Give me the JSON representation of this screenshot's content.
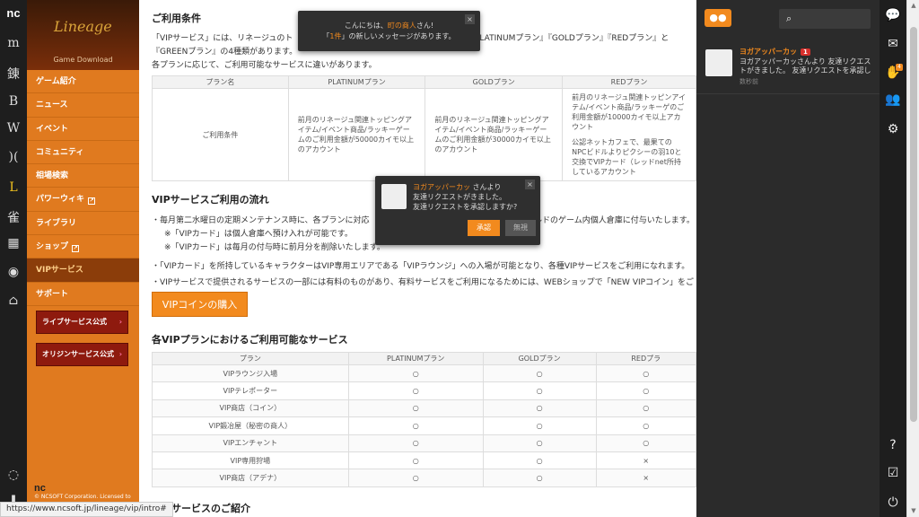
{
  "left_rail": {
    "logo": "nc",
    "items": [
      {
        "icon": "m-icon",
        "glyph": "m"
      },
      {
        "icon": "kanji-icon",
        "glyph": "錬"
      },
      {
        "icon": "bns-icon",
        "glyph": "B"
      },
      {
        "icon": "wings-icon",
        "glyph": "W"
      },
      {
        "icon": "parenthesis-icon",
        "glyph": ")("
      },
      {
        "icon": "lineage-icon",
        "glyph": "L"
      },
      {
        "icon": "kanji-game-icon",
        "glyph": "雀"
      },
      {
        "icon": "shop-icon",
        "glyph": "▦"
      },
      {
        "icon": "mask-icon",
        "glyph": "◉"
      },
      {
        "icon": "home-icon",
        "glyph": "⌂"
      }
    ],
    "bottom_icons": [
      {
        "icon": "chat-bubble-icon",
        "glyph": "◌"
      },
      {
        "icon": "user-icon",
        "glyph": "▮"
      }
    ]
  },
  "sidebar": {
    "brand": "Lineage",
    "game_download": "Game Download",
    "menu": [
      {
        "label": "ゲーム紹介",
        "ext": false,
        "active": false
      },
      {
        "label": "ニュース",
        "ext": false,
        "active": false
      },
      {
        "label": "イベント",
        "ext": false,
        "active": false
      },
      {
        "label": "コミュニティ",
        "ext": false,
        "active": false
      },
      {
        "label": "相場検索",
        "ext": false,
        "active": false
      },
      {
        "label": "パワーウィキ",
        "ext": true,
        "active": false
      },
      {
        "label": "ライブラリ",
        "ext": false,
        "active": false
      },
      {
        "label": "ショップ",
        "ext": true,
        "active": false
      },
      {
        "label": "VIPサービス",
        "ext": false,
        "active": true
      },
      {
        "label": "サポート",
        "ext": false,
        "active": false
      }
    ],
    "live_button": "ライブサービス公式",
    "origin_button": "オリジンサービス公式",
    "copyright_logo": "nc",
    "copyright": "© NCSOFT Corporation. Licensed to"
  },
  "main": {
    "section1_title": "ご利用条件",
    "intro_line1": "「VIPサービス」には、リネージュのト",
    "intro_line1b": "る『PLATINUMプラン』『GOLDプラン』『REDプラン』と",
    "intro_line2": "『GREENプラン』の4種類があります。",
    "intro_line3": "各プランに応じて、ご利用可能なサービスに違いがあります。",
    "cond_table": {
      "headers": [
        "プラン名",
        "PLATINUMプラン",
        "GOLDプラン",
        "REDプラン"
      ],
      "row_label": "ご利用条件",
      "platinum": "前月のリネージュ関連トッピングアイテム/イベント商品/ラッキーゲームのご利用金額が50000カイモ以上のアカウント",
      "gold": "前月のリネージュ関連トッピングアイテム/イベント商品/ラッキーゲームのご利用金額が30000カイモ以上のアカウント",
      "red1": "前月のリネージュ関連トッピンアイテム/イベント商品/ラッキーゲのご利用金額が10000カイモ以上アカウント",
      "red2": "公認ネットカフェで、最果ての NPCビドルよりピクシーの羽10と交換でVIPカード（レッドnet所持しているアカウント"
    },
    "section2_title": "VIPサービスご利用の流れ",
    "bullet1": "・毎月第二水曜日の定期メンテナンス時に、各プランに対応",
    "bullet1b": "ルドのゲーム内個人倉庫に付与いたします。",
    "note1": "※「VIPカード」は個人倉庫へ預け入れが可能です。",
    "note2": "※「VIPカード」は毎月の付与時に前月分を削除いたします。",
    "bullet2": "・「VIPカード」を所持しているキャラクターはVIP専用エリアである「VIPラウンジ」への入場が可能となり、各種VIPサービスをご利用になれます。",
    "bullet3": "・VIPサービスで提供されるサービスの一部には有料のものがあり、有料サービスをご利用になるためには、WEBショップで「NEW VIPコイン」をご",
    "vip_button": "VIPコインの購入",
    "section3_title": "各VIPプランにおけるご利用可能なサービス",
    "svc_table": {
      "headers": [
        "プラン",
        "PLATINUMプラン",
        "GOLDプラン",
        "REDプラ"
      ],
      "rows": [
        {
          "name": "VIPラウンジ入場",
          "p": "○",
          "g": "○",
          "r": "○"
        },
        {
          "name": "VIPテレポーター",
          "p": "○",
          "g": "○",
          "r": "○"
        },
        {
          "name": "VIP商店（コイン）",
          "p": "○",
          "g": "○",
          "r": "○"
        },
        {
          "name": "VIP鍛冶屋（秘密の商人）",
          "p": "○",
          "g": "○",
          "r": "○"
        },
        {
          "name": "VIPエンチャント",
          "p": "○",
          "g": "○",
          "r": "○"
        },
        {
          "name": "VIP専用狩場",
          "p": "○",
          "g": "○",
          "r": "×"
        },
        {
          "name": "VIP商店（アデナ）",
          "p": "○",
          "g": "○",
          "r": "×"
        }
      ]
    },
    "section4_title": "提供サービスのご紹介"
  },
  "toast": {
    "hello": "こんにちは、",
    "name": "町の商人",
    "suffix": "さん!",
    "count": "1件",
    "msg": "の新しいメッセージがあります。"
  },
  "friend_popup": {
    "name": "ヨガアッパーカッ",
    "after_name": " さんより",
    "line2": "友達リクエストがきました。",
    "line3": "友達リクエストを承認しますか?",
    "accept": "承認",
    "ignore": "無視"
  },
  "right_panel": {
    "search_placeholder": "",
    "notification": {
      "name": "ヨガアッパーカッ",
      "badge": "1",
      "message": "ヨガアッパーカッさんより 友達リクエストがきました。 友達リクエストを承認し",
      "time": "数秒前"
    }
  },
  "right_rail": {
    "icons": [
      "chat-icon",
      "inbox-icon",
      "friend-request-icon",
      "friends-icon",
      "settings-icon",
      "help-icon",
      "checklist-icon",
      "power-icon"
    ],
    "friend_badge": "4"
  },
  "status_url": "https://www.ncsoft.jp/lineage/vip/intro#",
  "colors": {
    "accent": "#f28a1e",
    "sidebar": "#e07a1f",
    "dark": "#2b2b2b"
  }
}
